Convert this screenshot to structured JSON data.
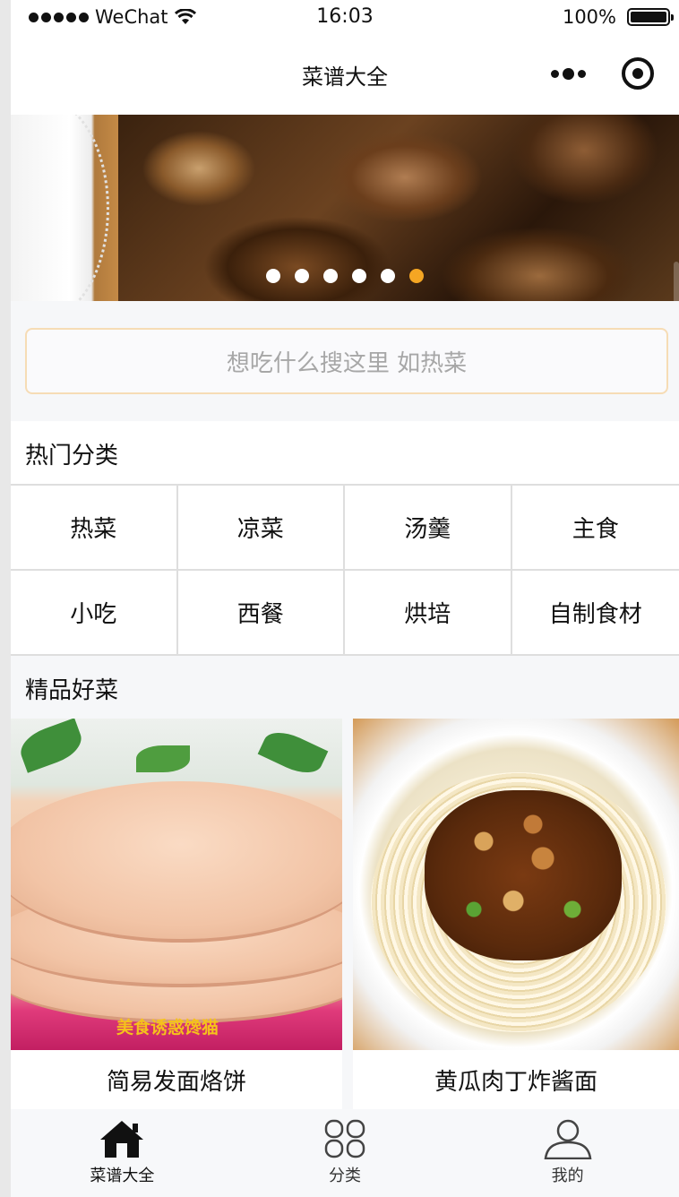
{
  "status_bar": {
    "carrier": "WeChat",
    "time": "16:03",
    "battery": "100%"
  },
  "nav": {
    "title": "菜谱大全"
  },
  "banner": {
    "slide_count": 6,
    "active_index": 5,
    "colors": {
      "dot": "#ffffff",
      "active_dot": "#f5a623"
    }
  },
  "search": {
    "placeholder": "想吃什么搜这里 如热菜"
  },
  "hot_categories": {
    "title": "热门分类",
    "items": [
      "热菜",
      "凉菜",
      "汤羹",
      "主食",
      "小吃",
      "西餐",
      "烘培",
      "自制食材"
    ]
  },
  "featured": {
    "title": "精品好菜",
    "recipes": [
      {
        "name": "简易发面烙饼",
        "watermark": "美食诱惑馋猫"
      },
      {
        "name": "黄瓜肉丁炸酱面"
      }
    ]
  },
  "tabbar": {
    "items": [
      {
        "label": "菜谱大全",
        "icon": "home-icon",
        "active": true
      },
      {
        "label": "分类",
        "icon": "category-grid-icon",
        "active": false
      },
      {
        "label": "我的",
        "icon": "user-icon",
        "active": false
      }
    ]
  }
}
